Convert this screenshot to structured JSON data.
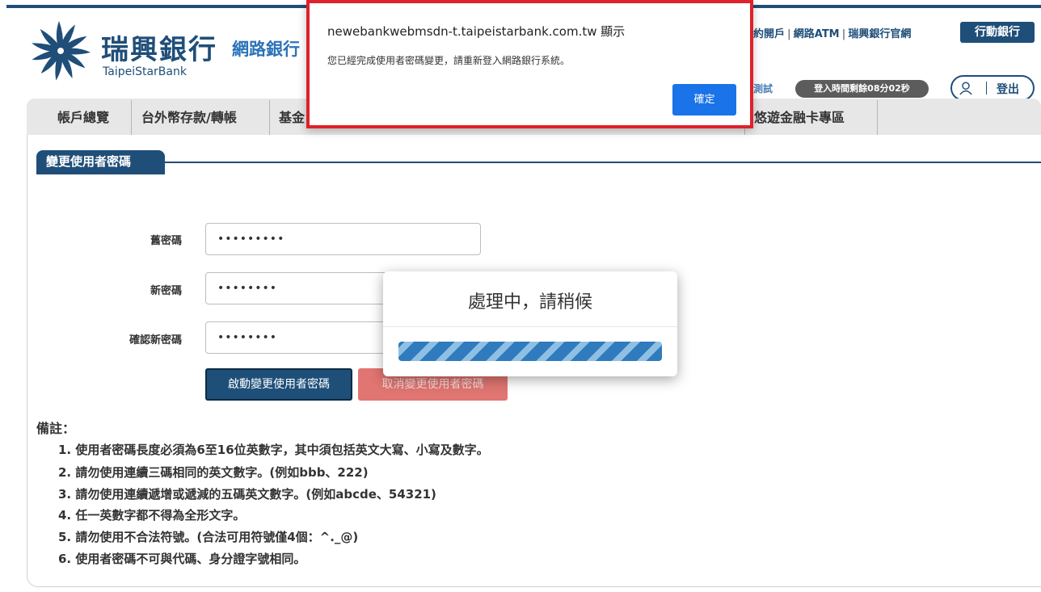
{
  "header": {
    "brand_zh": "瑞興銀行",
    "brand_en": "TaipeiStarBank",
    "brand_sub": "網路銀行",
    "logo_icon": "starburst-logo",
    "top_links": [
      {
        "label": "約開戶"
      },
      {
        "label": "網路ATM"
      },
      {
        "label": "瑞興銀行官網"
      }
    ],
    "link_separator": "|",
    "mobile_bank_label": "行動銀行",
    "test_label": "測試",
    "timer_text": "登入時間剩餘08分02秒",
    "logout_label": "登出",
    "colors": {
      "brand": "#1f4e79",
      "accent": "#2c73b8"
    }
  },
  "nav": {
    "items": [
      {
        "label": "帳戶總覽"
      },
      {
        "label": "台外幣存款/轉帳"
      },
      {
        "label": "基金"
      },
      {
        "label": "悠遊金融卡專區"
      }
    ]
  },
  "form": {
    "section_title": "變更使用者密碼",
    "fields": [
      {
        "label": "舊密碼",
        "value": "•••••••••"
      },
      {
        "label": "新密碼",
        "value": "••••••••"
      },
      {
        "label": "確認新密碼",
        "value": "••••••••"
      }
    ],
    "submit_label": "啟動變更使用者密碼",
    "cancel_label": "取消變更使用者密碼"
  },
  "notes": {
    "title": "備註：",
    "items": [
      "1. 使用者密碼長度必須為6至16位英數字，其中須包括英文大寫、小寫及數字。",
      "2. 請勿使用連續三碼相同的英文數字。(例如bbb、222)",
      "3. 請勿使用連續遞增或遞減的五碼英文數字。(例如abcde、54321)",
      "4. 任一英數字都不得為全形文字。",
      "5. 請勿使用不合法符號。(合法可用符號僅4個：^._@)",
      "6. 使用者密碼不可與代碼、身分證字號相同。"
    ]
  },
  "processing_modal": {
    "title": "處理中，請稍候",
    "progress": 1.0
  },
  "alert": {
    "origin": "newebankwebmsdn-t.taipeistarbank.com.tw 顯示",
    "message": "您已經完成使用者密碼變更，請重新登入網路銀行系統。",
    "ok_label": "確定",
    "highlight_color": "#e0202a"
  }
}
